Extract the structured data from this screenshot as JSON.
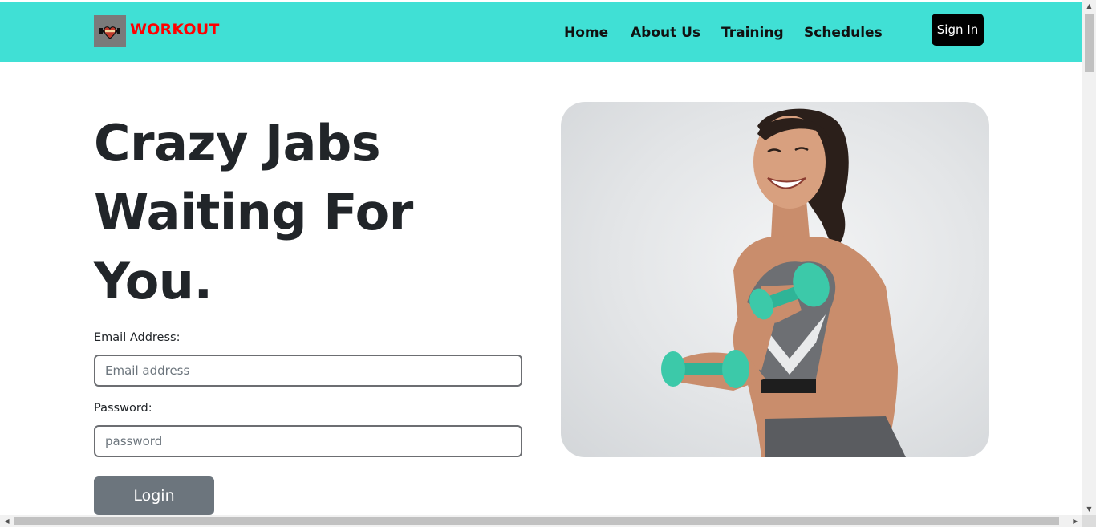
{
  "brand": {
    "name": "WORKOUT",
    "logo_icon": "heart-dumbbell-icon"
  },
  "nav": {
    "links": [
      "Home",
      "About Us",
      "Training",
      "Schedules"
    ],
    "signin_label": "Sign In"
  },
  "hero": {
    "title_lines": [
      "Crazy Jabs",
      "Waiting For",
      "You."
    ],
    "image_alt": "woman-lifting-dumbbells"
  },
  "form": {
    "email_label": "Email Address:",
    "email_placeholder": "Email address",
    "password_label": "Password:",
    "password_placeholder": "password",
    "login_label": "Login"
  },
  "colors": {
    "navbar_bg": "#40e0d5",
    "brand_text": "#ff0000",
    "signin_bg": "#000000",
    "login_bg": "#6c757d",
    "dumbbell": "#3cc9a9"
  }
}
